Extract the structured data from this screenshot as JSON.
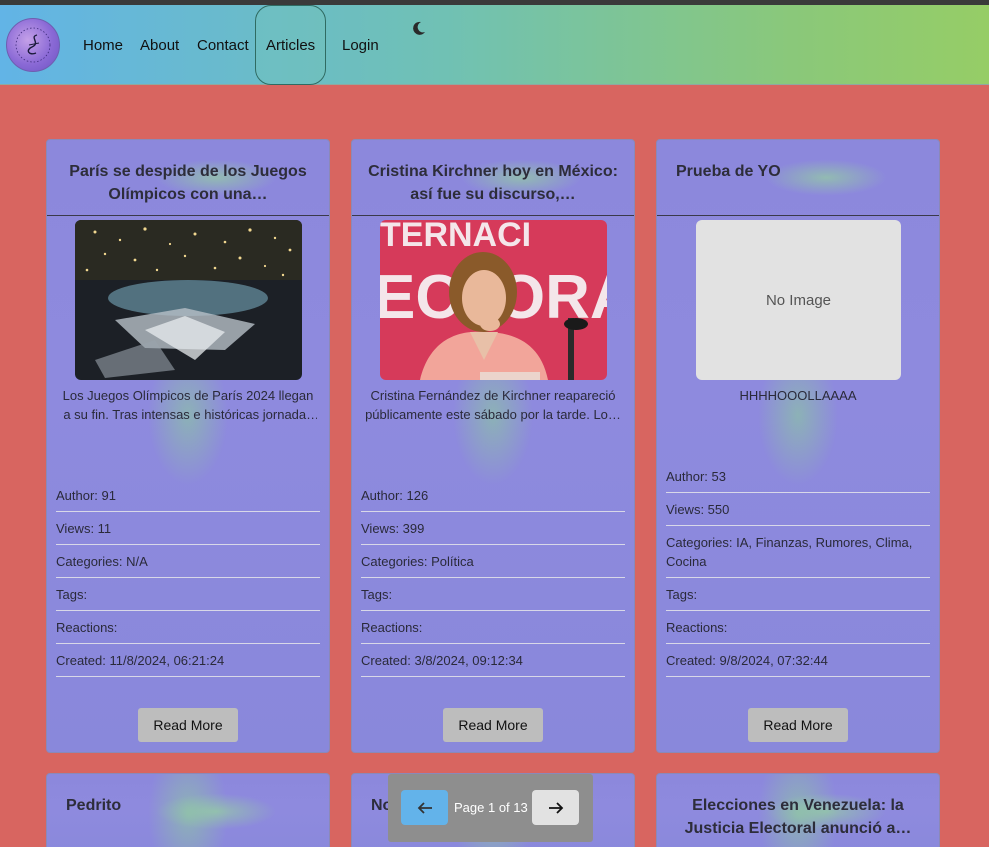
{
  "nav": {
    "logo_alt": "logo",
    "links": [
      "Home",
      "About",
      "Contact",
      "Articles",
      "Login"
    ]
  },
  "cards": [
    {
      "title": "París se despide de los Juegos Olímpicos con una…",
      "image": "olympics-ceremony",
      "desc": "Los Juegos Olímpicos de París 2024 llegan a su fin. Tras intensas e históricas jornadas e…",
      "author": "Author: 91",
      "views": "Views: 11",
      "categories": "Categories: N/A",
      "tags": "Tags:",
      "reactions": "Reactions:",
      "created": "Created: 11/8/2024, 06:21:24",
      "button": "Read More"
    },
    {
      "title": "Cristina Kirchner hoy en México: así fue su discurso,…",
      "image": "cristina-kirchner",
      "desc": "Cristina Fernández de Kirchner reapareció públicamente este sábado por la tarde. Lo…",
      "author": "Author: 126",
      "views": "Views: 399",
      "categories": "Categories: Política",
      "tags": "Tags:",
      "reactions": "Reactions:",
      "created": "Created: 3/8/2024, 09:12:34",
      "button": "Read More"
    },
    {
      "title": "Prueba de YO",
      "image_placeholder": "No Image",
      "desc": "HHHHOOOLLAAAA",
      "author": "Author: 53",
      "views": "Views: 550",
      "categories": "Categories: IA, Finanzas, Rumores, Clima, Cocina",
      "tags": "Tags:",
      "reactions": "Reactions:",
      "created": "Created: 9/8/2024, 07:32:44",
      "button": "Read More"
    }
  ],
  "row2": [
    {
      "title": "Pedrito"
    },
    {
      "title": "No"
    },
    {
      "title": "Elecciones en Venezuela: la Justicia Electoral anunció a…"
    }
  ],
  "pager": {
    "label": "Page 1 of 13",
    "prev_icon": "arrow-left-icon",
    "next_icon": "arrow-right-icon"
  }
}
